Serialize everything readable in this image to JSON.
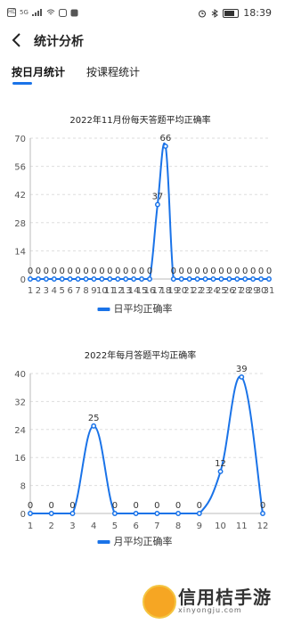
{
  "status_bar": {
    "left_icons": [
      "HD",
      "5G"
    ],
    "time": "18:39"
  },
  "header": {
    "title": "统计分析"
  },
  "tabs": [
    {
      "label": "按日月统计",
      "active": true
    },
    {
      "label": "按课程统计",
      "active": false
    }
  ],
  "accent_color": "#1a73e8",
  "chart_data": [
    {
      "type": "line",
      "title": "2022年11月份每天答题平均正确率",
      "categories": [
        "1",
        "2",
        "3",
        "4",
        "5",
        "6",
        "7",
        "8",
        "9",
        "10",
        "11",
        "12",
        "13",
        "14",
        "15",
        "16",
        "17",
        "18",
        "19",
        "20",
        "21",
        "22",
        "23",
        "24",
        "25",
        "26",
        "27",
        "28",
        "29",
        "30",
        "31"
      ],
      "series": [
        {
          "name": "日平均正确率",
          "values": [
            0,
            0,
            0,
            0,
            0,
            0,
            0,
            0,
            0,
            0,
            0,
            0,
            0,
            0,
            0,
            0,
            37,
            66,
            0,
            0,
            0,
            0,
            0,
            0,
            0,
            0,
            0,
            0,
            0,
            0,
            0
          ]
        }
      ],
      "ylim": [
        0,
        70
      ],
      "yticks": [
        0,
        14,
        28,
        42,
        56,
        70
      ],
      "grid": "horizontal",
      "legend": "bottom"
    },
    {
      "type": "line",
      "title": "2022年每月答题平均正确率",
      "categories": [
        "1",
        "2",
        "3",
        "4",
        "5",
        "6",
        "7",
        "8",
        "9",
        "10",
        "11",
        "12"
      ],
      "series": [
        {
          "name": "月平均正确率",
          "values": [
            0,
            0,
            0,
            25,
            0,
            0,
            0,
            0,
            0,
            12,
            39,
            0
          ]
        }
      ],
      "ylim": [
        0,
        40
      ],
      "yticks": [
        0,
        8,
        16,
        24,
        32,
        40
      ],
      "grid": "horizontal",
      "legend": "bottom"
    }
  ],
  "watermark": {
    "text": "信用桔手游",
    "url": "xinyongju.com"
  }
}
